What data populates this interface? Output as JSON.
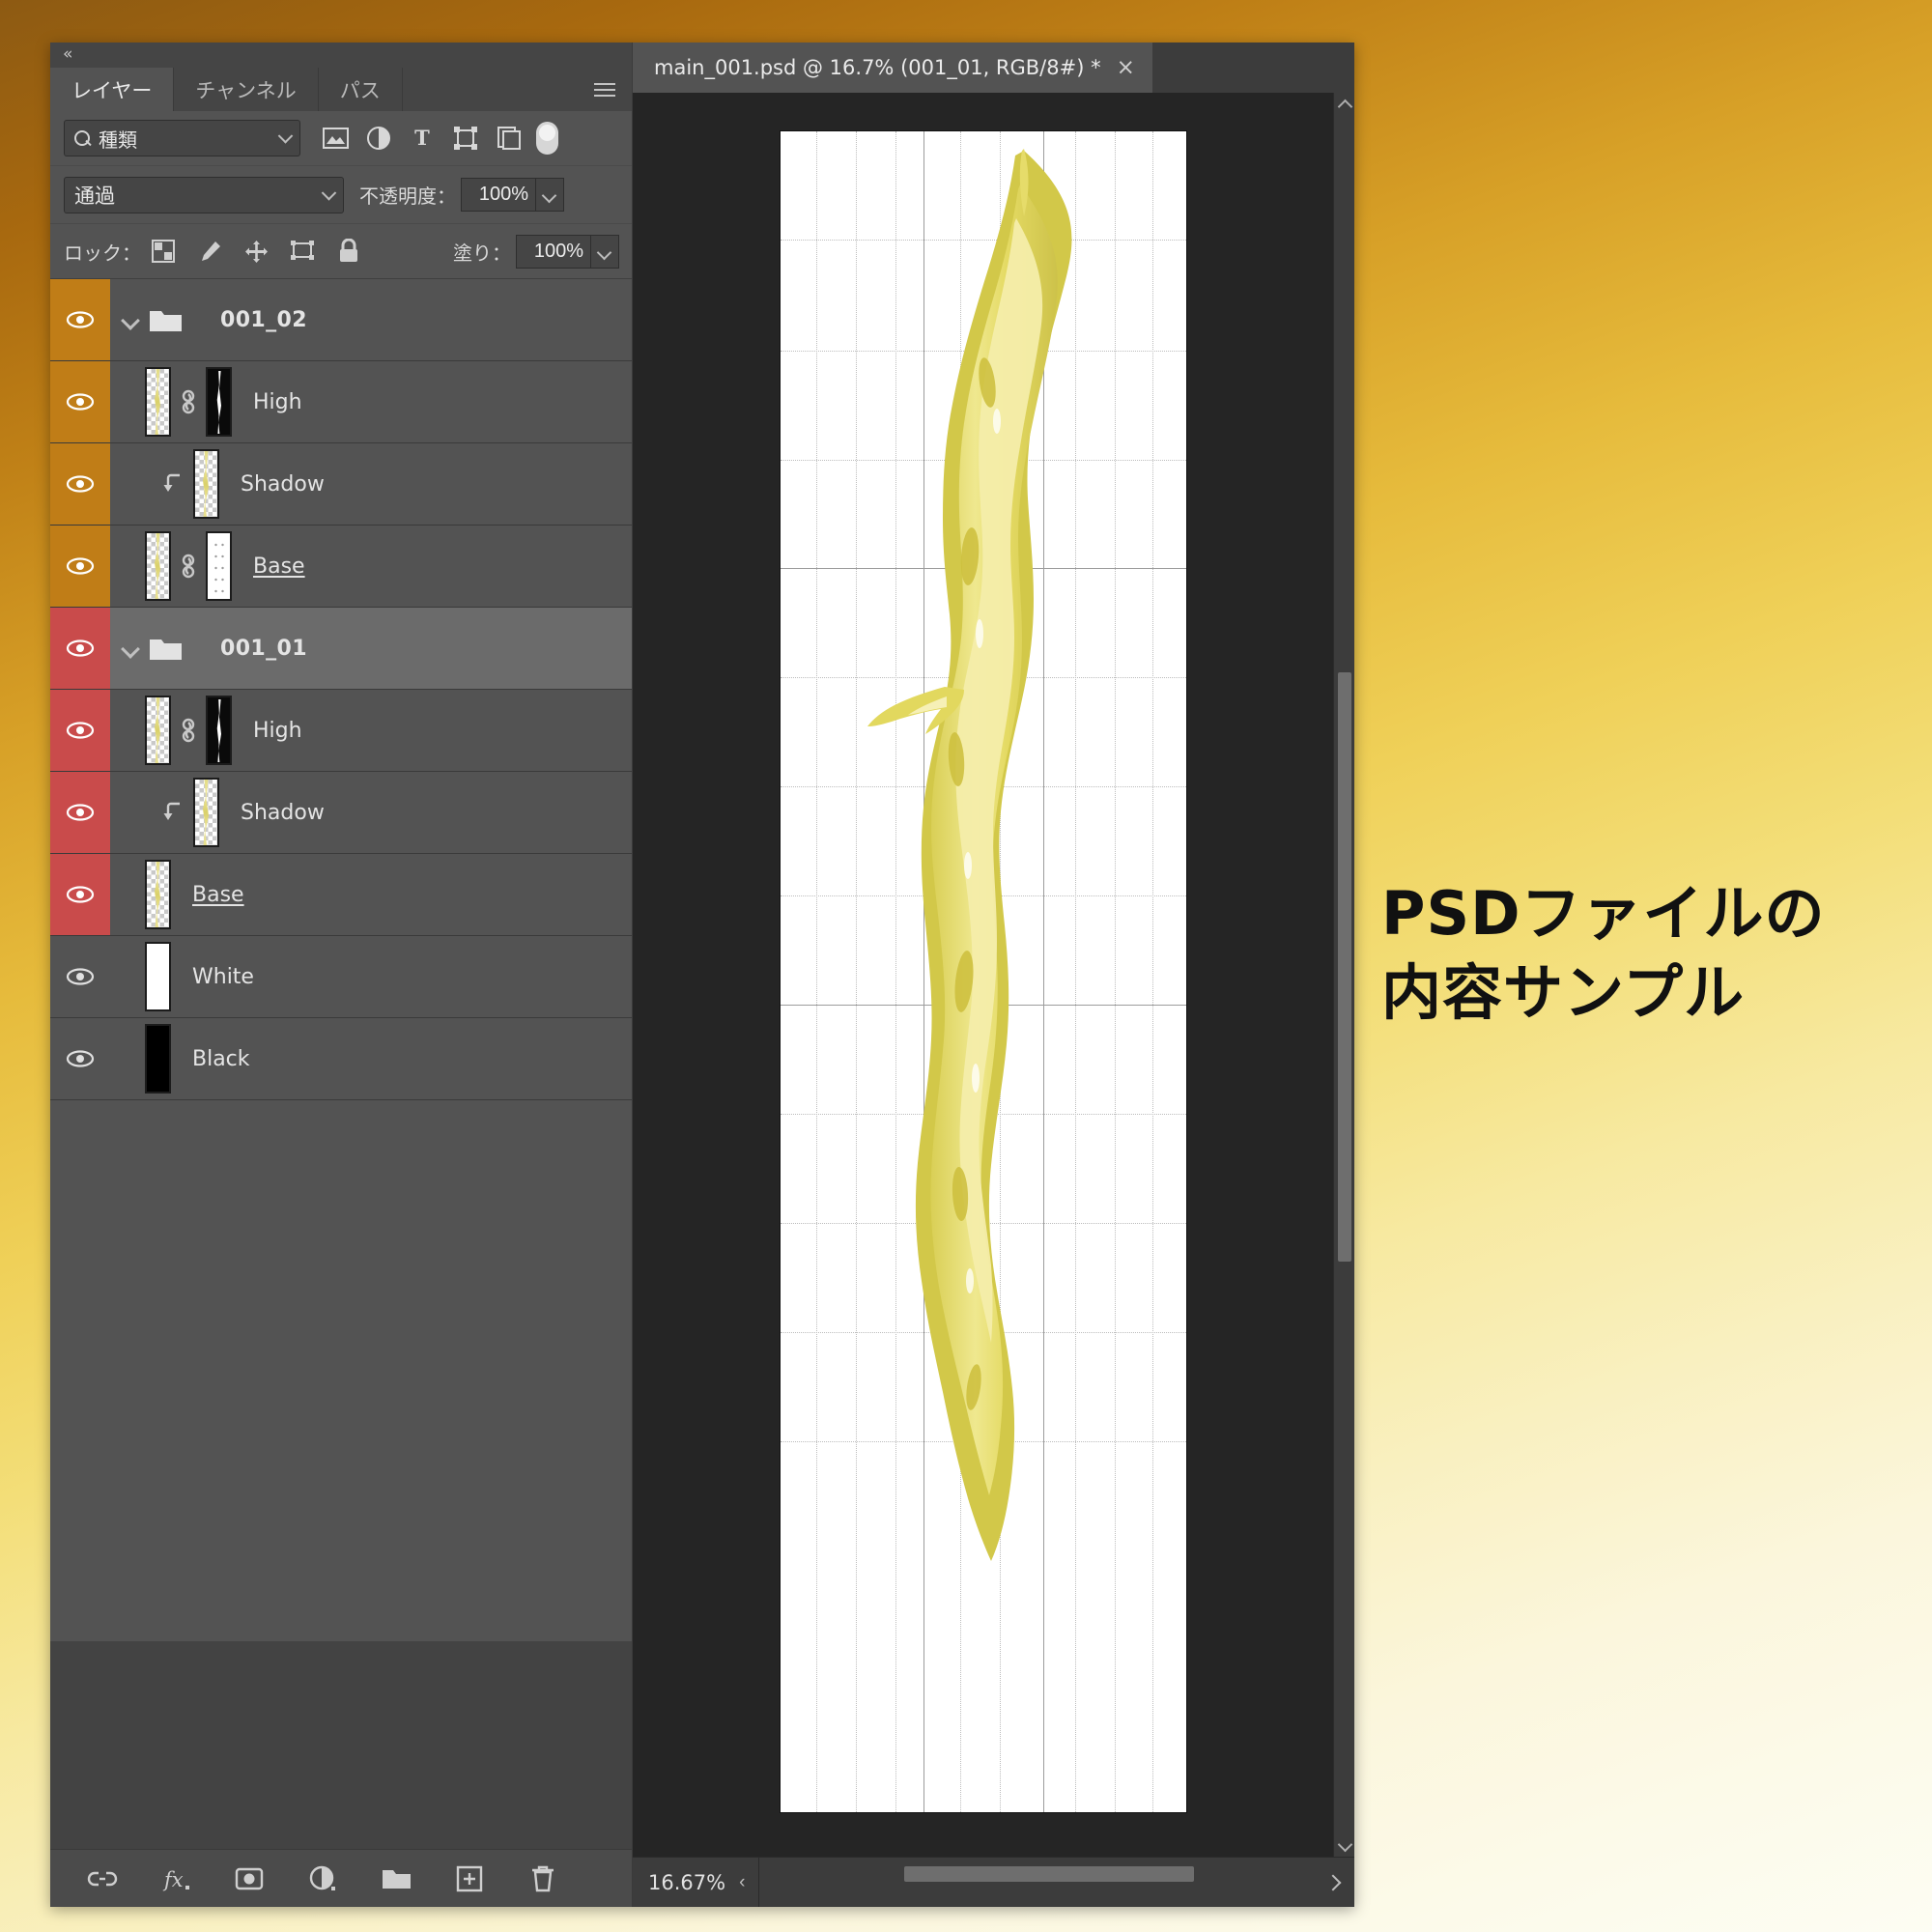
{
  "window": {
    "collapse_icon": "collapse-double-arrow-left"
  },
  "panel": {
    "tabs": [
      {
        "label": "レイヤー",
        "active": true
      },
      {
        "label": "チャンネル",
        "active": false
      },
      {
        "label": "パス",
        "active": false
      }
    ],
    "menu_icon": "panel-menu-icon",
    "filter": {
      "search_icon": "search-icon",
      "kind_label": "種類",
      "chevron_icon": "chevron-down-icon",
      "icons": [
        "pixel-layer-filter-icon",
        "adjustment-layer-filter-icon",
        "type-layer-filter-icon",
        "shape-layer-filter-icon",
        "smart-object-filter-icon"
      ],
      "toggle_icon": "filter-enable-toggle"
    },
    "blend": {
      "mode": "通過",
      "opacity_label": "不透明度：",
      "opacity_value": "100%",
      "fill_label": "塗り：",
      "fill_value": "100%"
    },
    "lock": {
      "label": "ロック：",
      "icons": [
        "lock-transparent-pixels-icon",
        "lock-image-pixels-icon",
        "lock-position-icon",
        "lock-artboard-nesting-icon",
        "lock-all-icon"
      ]
    },
    "layers": [
      {
        "name": "001_02",
        "type": "group",
        "indent": 0,
        "tag_color": "#c07d17",
        "selected": false,
        "expanded": true,
        "visible": true,
        "has_mask": false,
        "clipped": false,
        "underline": false
      },
      {
        "name": "High",
        "type": "layer",
        "indent": 1,
        "tag_color": "#c07d17",
        "selected": false,
        "visible": true,
        "has_mask": true,
        "mask_kind": "black",
        "linked": true,
        "clipped": false,
        "underline": false
      },
      {
        "name": "Shadow",
        "type": "layer",
        "indent": 2,
        "tag_color": "#c07d17",
        "selected": false,
        "visible": true,
        "has_mask": false,
        "linked": false,
        "clipped": true,
        "underline": false
      },
      {
        "name": "Base",
        "type": "layer",
        "indent": 1,
        "tag_color": "#c07d17",
        "selected": false,
        "visible": true,
        "has_mask": true,
        "mask_kind": "white",
        "linked": true,
        "clipped": false,
        "underline": true
      },
      {
        "name": "001_01",
        "type": "group",
        "indent": 0,
        "tag_color": "#c94b4b",
        "selected": true,
        "expanded": true,
        "visible": true,
        "has_mask": false,
        "clipped": false,
        "underline": false
      },
      {
        "name": "High",
        "type": "layer",
        "indent": 1,
        "tag_color": "#c94b4b",
        "selected": false,
        "visible": true,
        "has_mask": true,
        "mask_kind": "black",
        "linked": true,
        "clipped": false,
        "underline": false
      },
      {
        "name": "Shadow",
        "type": "layer",
        "indent": 2,
        "tag_color": "#c94b4b",
        "selected": false,
        "visible": true,
        "has_mask": false,
        "linked": false,
        "clipped": true,
        "underline": false
      },
      {
        "name": "Base",
        "type": "layer",
        "indent": 1,
        "tag_color": "#c94b4b",
        "selected": false,
        "visible": true,
        "has_mask": false,
        "linked": false,
        "clipped": false,
        "underline": true
      },
      {
        "name": "White",
        "type": "solid",
        "indent": 1,
        "tag_color": "",
        "selected": false,
        "visible": true,
        "swatch": "#ffffff"
      },
      {
        "name": "Black",
        "type": "solid",
        "indent": 1,
        "tag_color": "",
        "selected": false,
        "visible": true,
        "swatch": "#000000"
      }
    ],
    "footer_icons": [
      "link-layers-icon",
      "layer-style-fx-icon",
      "add-layer-mask-icon",
      "new-adjustment-layer-icon",
      "new-group-icon",
      "new-layer-icon",
      "delete-layer-icon"
    ]
  },
  "document": {
    "tab_title": "main_001.psd @ 16.7% (001_01, RGB/8#) *",
    "close_icon": "close-icon",
    "zoom_level": "16.67%",
    "status_arrow_icon": "chevron-left-icon",
    "scroll_right_icon": "chevron-right-icon"
  },
  "caption": {
    "line1": "PSDファイルの",
    "line2": "内容サンプル"
  },
  "colors": {
    "panel_bg": "#535353",
    "panel_header": "#454545",
    "tag_orange": "#c07d17",
    "tag_red": "#c94b4b",
    "selected_row": "#6b6b6b",
    "canvas_bg": "#252525",
    "artwork_yellow": "#e3d85f"
  }
}
